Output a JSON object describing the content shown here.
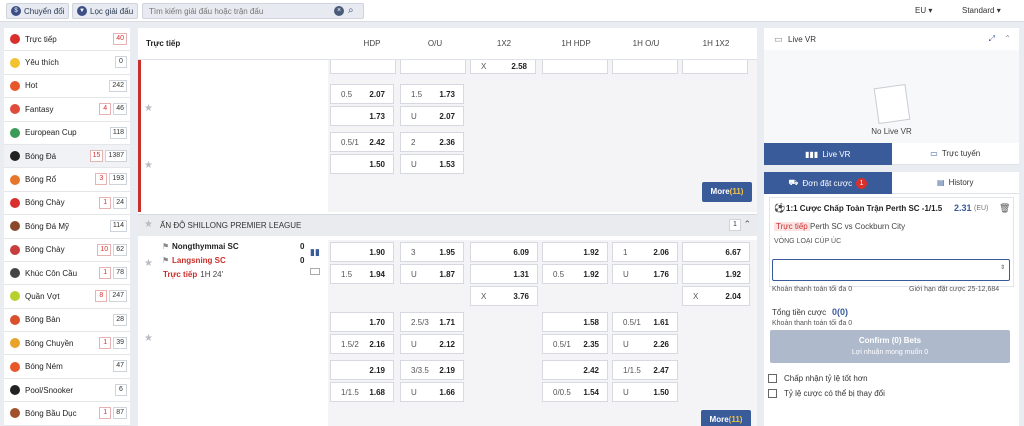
{
  "topbar": {
    "convert_label": "Chuyển đổi",
    "filter_label": "Lọc giải đấu",
    "search_placeholder": "Tìm kiếm giải đấu hoặc trận đấu",
    "odds_format": "EU",
    "view_mode": "Standard"
  },
  "sidebar": {
    "items": [
      {
        "label": "Trực tiếp",
        "live": "40",
        "count": "",
        "color": "#d9302e"
      },
      {
        "label": "Yêu thích",
        "live": "",
        "count": "0",
        "color": "#f2c230"
      },
      {
        "label": "Hot",
        "live": "",
        "count": "242",
        "color": "#e8572a"
      },
      {
        "label": "Fantasy",
        "live": "4",
        "count": "46",
        "color": "#e04b3b"
      },
      {
        "label": "European Cup",
        "live": "",
        "count": "118",
        "color": "#3a9b57"
      },
      {
        "label": "Bóng Đá",
        "live": "15",
        "count": "1387",
        "color": "#222222"
      },
      {
        "label": "Bóng Rổ",
        "live": "3",
        "count": "193",
        "color": "#e8762a"
      },
      {
        "label": "Bóng Chày",
        "live": "1",
        "count": "24",
        "color": "#d9302e"
      },
      {
        "label": "Bóng Đá Mỹ",
        "live": "",
        "count": "114",
        "color": "#8a4a2a"
      },
      {
        "label": "Bóng Chày",
        "live": "10",
        "count": "62",
        "color": "#c93d3d"
      },
      {
        "label": "Khúc Côn Cầu",
        "live": "1",
        "count": "78",
        "color": "#444444"
      },
      {
        "label": "Quần Vợt",
        "live": "8",
        "count": "247",
        "color": "#b8d12f"
      },
      {
        "label": "Bóng Bàn",
        "live": "",
        "count": "28",
        "color": "#d9502e"
      },
      {
        "label": "Bóng Chuyền",
        "live": "1",
        "count": "39",
        "color": "#e8a32a"
      },
      {
        "label": "Bóng Ném",
        "live": "",
        "count": "47",
        "color": "#e8572a"
      },
      {
        "label": "Pool/Snooker",
        "live": "",
        "count": "6",
        "color": "#222222"
      },
      {
        "label": "Bóng Bầu Dục",
        "live": "1",
        "count": "87",
        "color": "#a0502a"
      }
    ]
  },
  "main": {
    "header": {
      "title": "Trực tiếp",
      "cols": [
        "HDP",
        "O/U",
        "1X2",
        "1H HDP",
        "1H O/U",
        "1H 1X2"
      ]
    },
    "top_cells": {
      "x_label": "X",
      "x_val": "2.58",
      "r1": {
        "h_l": "0.5",
        "h_v": "2.07",
        "o_l": "1.5",
        "o_v": "1.73"
      },
      "r2": {
        "h_v": "1.73",
        "o_l": "U",
        "o_v": "2.07"
      },
      "r3": {
        "h_l": "0.5/1",
        "h_v": "2.42",
        "o_l": "2",
        "o_v": "2.36"
      },
      "r4": {
        "h_v": "1.50",
        "o_l": "U",
        "o_v": "1.53"
      }
    },
    "more_label": "More",
    "more_count": "(11)",
    "league": {
      "name": "ẤN ĐỘ SHILLONG PREMIER LEAGUE",
      "count": "1"
    },
    "match": {
      "home": "Nongthymmai SC",
      "away": "Langsning SC",
      "home_score": "0",
      "away_score": "0",
      "live_label": "Trực tiếp",
      "time": "1H 24'"
    },
    "m1": {
      "a": {
        "h_v": "1.90",
        "o_l": "3",
        "o_v": "1.95",
        "x_v": "6.09",
        "hh_v": "1.92",
        "ho_l": "1",
        "ho_v": "2.06",
        "hx_v": "6.67"
      },
      "b": {
        "h_l": "1.5",
        "h_v": "1.94",
        "o_l": "U",
        "o_v": "1.87",
        "x_v": "1.31",
        "hh_l": "0.5",
        "hh_v": "1.92",
        "ho_l": "U",
        "ho_v": "1.76",
        "hx_v": "1.92"
      },
      "c": {
        "x_l": "X",
        "x_v": "3.76",
        "hx_l": "X",
        "hx_v": "2.04"
      }
    },
    "m2": {
      "a": {
        "h_v": "1.70",
        "o_l": "2.5/3",
        "o_v": "1.71",
        "hh_v": "1.58",
        "ho_l": "0.5/1",
        "ho_v": "1.61"
      },
      "b": {
        "h_l": "1.5/2",
        "h_v": "2.16",
        "o_l": "U",
        "o_v": "2.12",
        "hh_l": "0.5/1",
        "hh_v": "2.35",
        "ho_l": "U",
        "ho_v": "2.26"
      }
    },
    "m3": {
      "a": {
        "h_v": "2.19",
        "o_l": "3/3.5",
        "o_v": "2.19",
        "hh_v": "2.42",
        "ho_l": "1/1.5",
        "ho_v": "2.47"
      },
      "b": {
        "h_l": "1/1.5",
        "h_v": "1.68",
        "o_l": "U",
        "o_v": "1.66",
        "hh_l": "0/0.5",
        "hh_v": "1.54",
        "ho_l": "U",
        "ho_v": "1.50"
      }
    }
  },
  "right": {
    "live_vr_title": "Live VR",
    "no_live_vr": "No Live VR",
    "tab_live_vr": "Live VR",
    "tab_online": "Trực tuyến",
    "tab_betslip": "Đơn đặt cược",
    "betslip_count": "1",
    "tab_history": "History",
    "bet_title": "1:1 Cược Chấp Toàn Trận Perth SC -1/1.5",
    "bet_odds": "2.31",
    "bet_format": "(EU)",
    "bet_live": "Trực tiếp",
    "bet_match": "Perth SC vs Cockburn City",
    "bet_league": "VÒNG LOẠI CÚP ÚC",
    "min_pay": "Khoản thanh toán tối đa 0",
    "limit": "Giới hạn đặt cược 25-12,684",
    "total_label": "Tổng tiền cược",
    "total_val": "0(0)",
    "max_pay": "Khoản thanh toán tối đa 0",
    "confirm_label": "Confirm (0) Bets",
    "profit_label": "Lợi nhuận mong muốn 0",
    "opt1": "Chấp nhận tỷ lệ tốt hơn",
    "opt2": "Tỷ lệ cược có thể bị thay đổi"
  }
}
